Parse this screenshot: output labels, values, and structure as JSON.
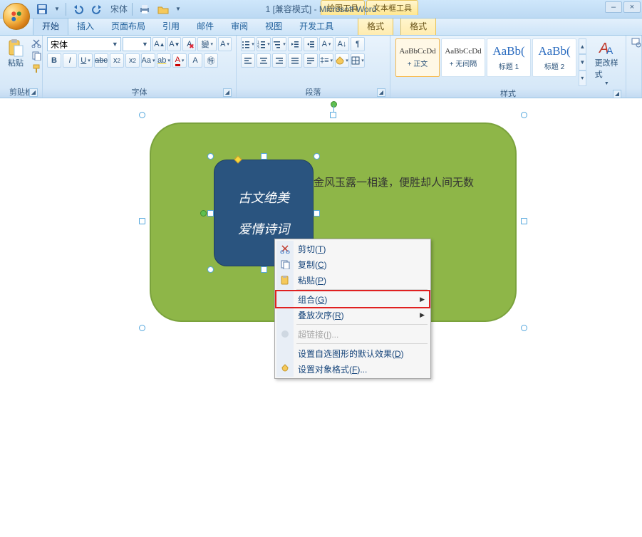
{
  "title_suffix": "1 [兼容模式] - Microsoft Word",
  "qat_font": "宋体",
  "context_tabs": {
    "draw": "绘图工具",
    "textbox": "文本框工具"
  },
  "tabs": {
    "home": "开始",
    "insert": "插入",
    "layout": "页面布局",
    "ref": "引用",
    "mail": "邮件",
    "review": "审阅",
    "view": "视图",
    "dev": "开发工具",
    "fmt1": "格式",
    "fmt2": "格式"
  },
  "groups": {
    "clipboard": "剪贴板",
    "font": "字体",
    "paragraph": "段落",
    "styles": "样式"
  },
  "clipboard": {
    "paste": "粘贴"
  },
  "font": {
    "name": "宋体",
    "size": ""
  },
  "styles": {
    "items": [
      {
        "preview": "AaBbCcDd",
        "name": "+ 正文",
        "sel": true,
        "cls": ""
      },
      {
        "preview": "AaBbCcDd",
        "name": "+ 无间隔",
        "sel": false,
        "cls": ""
      },
      {
        "preview": "AaBb(",
        "name": "标题 1",
        "sel": false,
        "cls": "blue big"
      },
      {
        "preview": "AaBb(",
        "name": "标题 2",
        "sel": false,
        "cls": "blue big"
      }
    ],
    "change": "更改样式"
  },
  "shape": {
    "title1": "古文绝美",
    "title2": "爱情诗词",
    "body": "金风玉露一相逢，便胜却人间无数"
  },
  "ctxmenu": {
    "cut": "剪切(T)",
    "copy": "复制(C)",
    "paste": "粘贴(P)",
    "group": "组合(G)",
    "order": "叠放次序(R)",
    "hyperlink": "超链接(I)...",
    "defaults": "设置自选图形的默认效果(D)",
    "format": "设置对象格式(F)..."
  }
}
